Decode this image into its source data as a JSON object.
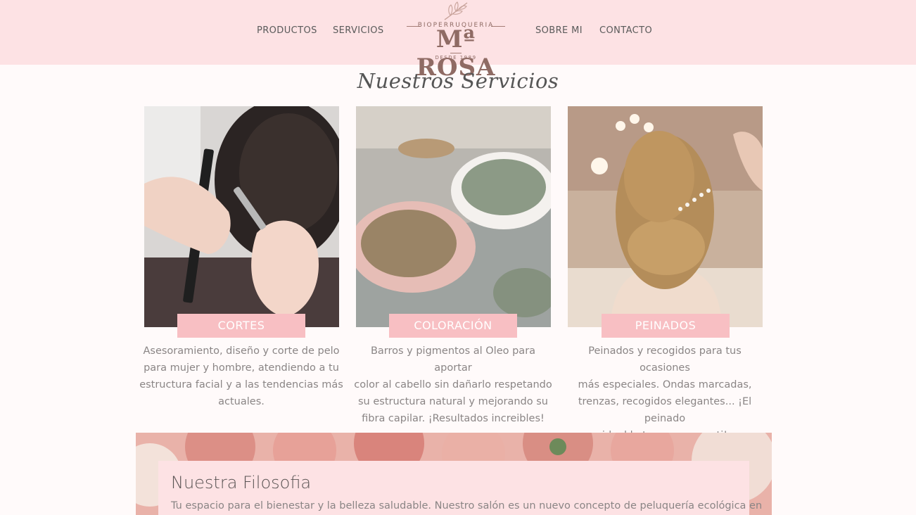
{
  "header": {
    "nav_left": [
      "PRODUCTOS",
      "SERVICIOS"
    ],
    "nav_right": [
      "SOBRE MI",
      "CONTACTO"
    ],
    "logo": {
      "top_text": "BIOPERRUQUERIA",
      "name": "Mª ROSA",
      "since": "DESDE 1989"
    }
  },
  "services": {
    "title": "Nuestros Servicios",
    "cards": [
      {
        "label": "CORTES",
        "text_lines": [
          "Asesoramiento, diseño y corte de pelo",
          "para mujer y hombre, atendiendo a tu",
          "estructura facial y a las tendencias más",
          "actuales."
        ]
      },
      {
        "label": "COLORACIÓN",
        "text_lines": [
          "Barros y pigmentos al Oleo para aportar",
          "color al cabello sin dañarlo respetando",
          "su estructura natural y mejorando su",
          "fibra capilar. ¡Resultados increibles!"
        ]
      },
      {
        "label": "PEINADOS",
        "text_lines": [
          "Peinados y recogidos para tus ocasiones",
          "más especiales. Ondas marcadas,",
          "trenzas, recogidos elegantes... ¡El peinado",
          "ideal lo tenemos para ti!"
        ]
      }
    ]
  },
  "philosophy": {
    "title": "Nuestra Filosofia",
    "text": "Tu espacio para el bienestar y la belleza saludable. Nuestro salón es un nuevo concepto de peluquería ecológica en"
  },
  "colors": {
    "header_bg": "#fde2e4",
    "label_bg": "#f8bfc3",
    "logo_color": "#8f6b64"
  }
}
